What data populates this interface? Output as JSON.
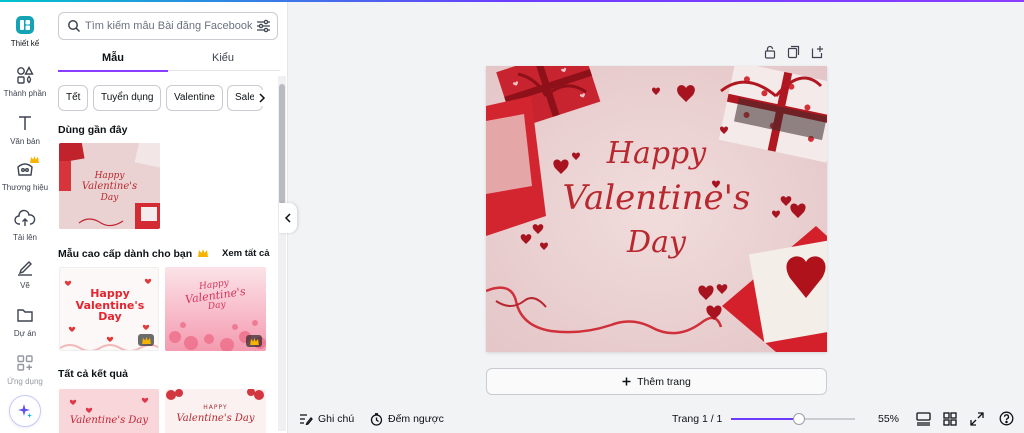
{
  "rail": {
    "items": [
      {
        "label": "Thiết kế",
        "icon": "design-icon",
        "active": true
      },
      {
        "label": "Thành phần",
        "icon": "elements-icon"
      },
      {
        "label": "Văn bản",
        "icon": "text-icon"
      },
      {
        "label": "Thương hiệu",
        "icon": "brand-icon"
      },
      {
        "label": "Tải lên",
        "icon": "upload-icon"
      },
      {
        "label": "Vẽ",
        "icon": "draw-icon"
      },
      {
        "label": "Dự án",
        "icon": "folder-icon"
      },
      {
        "label": "Ứng dụng",
        "icon": "apps-icon"
      }
    ],
    "magic_icon": "magic-sparkle-icon"
  },
  "panel": {
    "search_placeholder": "Tìm kiếm mẫu Bài đăng Facebook",
    "tabs": [
      "Mẫu",
      "Kiểu"
    ],
    "chips": [
      "Tết",
      "Tuyển dụng",
      "Valentine",
      "Sale"
    ],
    "recent_title": "Dùng gần đây",
    "premium_title": "Mẫu cao cấp dành cho bạn",
    "see_all": "Xem tất cả",
    "all_results_title": "Tất cả kết quả",
    "thumb_texts": {
      "recent": [
        "Happy",
        "Valentine's",
        "Day"
      ],
      "premium1": [
        "Happy",
        "Valentine's",
        "Day"
      ],
      "premium2": [
        "Happy",
        "Valentine's",
        "Day"
      ],
      "result1": "Valentine's Day",
      "result2_top": "HAPPY",
      "result2": "Valentine's Day"
    }
  },
  "canvas": {
    "lines": [
      "Happy",
      "Valentine's",
      "Day"
    ],
    "add_page": "Thêm trang",
    "accent_red": "#c8242f",
    "text_red": "#b8282f",
    "background_pink": "#ecd4d4"
  },
  "bottom": {
    "notes": "Ghi chú",
    "timer": "Đếm ngược",
    "page_indicator": "Trang 1 / 1",
    "zoom": "55%",
    "zoom_level": 0.55
  },
  "colors": {
    "accent": "#8b3dff"
  }
}
